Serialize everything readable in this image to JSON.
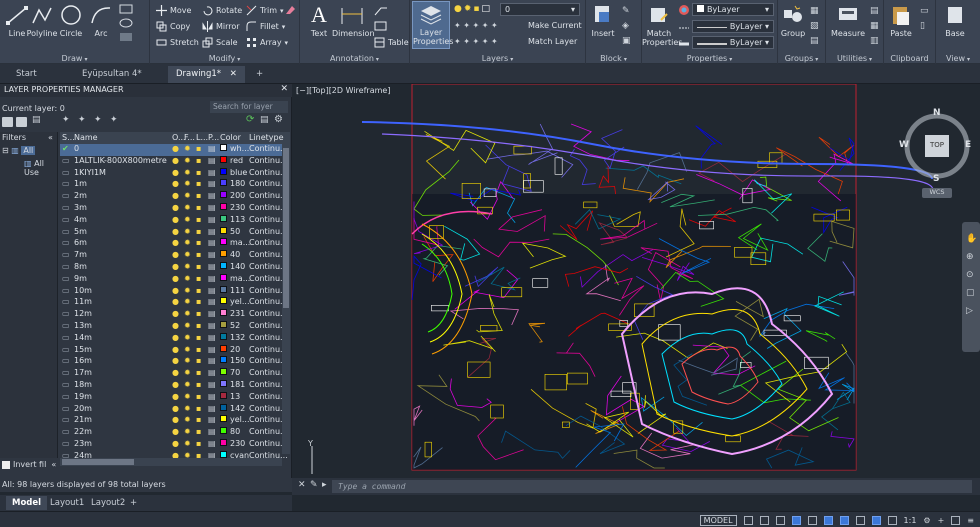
{
  "ribbon": {
    "draw": {
      "line": "Line",
      "polyline": "Polyline",
      "circle": "Circle",
      "arc": "Arc",
      "group": "Draw"
    },
    "modify": {
      "move": "Move",
      "rotate": "Rotate",
      "trim": "Trim",
      "copy": "Copy",
      "mirror": "Mirror",
      "fillet": "Fillet",
      "stretch": "Stretch",
      "scale": "Scale",
      "array": "Array",
      "group": "Modify"
    },
    "annotation": {
      "text": "Text",
      "dimension": "Dimension",
      "table": "Table",
      "group": "Annotation"
    },
    "layers": {
      "layer_properties": "Layer Properties",
      "current_layer": "0",
      "make_current": "Make Current",
      "match_layer": "Match Layer",
      "group": "Layers"
    },
    "block": {
      "insert": "Insert",
      "group": "Block"
    },
    "properties": {
      "match_properties": "Match Properties",
      "color": "ByLayer",
      "linetype": "ByLayer",
      "lineweight": "ByLayer",
      "group": "Properties"
    },
    "groups": {
      "group_btn": "Group",
      "group": "Groups"
    },
    "utilities": {
      "measure": "Measure",
      "group": "Utilities"
    },
    "clipboard": {
      "paste": "Paste",
      "group": "Clipboard"
    },
    "view": {
      "base": "Base",
      "group": "View"
    }
  },
  "doc_tabs": [
    "Start",
    "Eyüpsultan 4*",
    "Drawing1*"
  ],
  "lpm": {
    "title": "LAYER PROPERTIES MANAGER",
    "current_layer": "Current layer: 0",
    "search_placeholder": "Search for layer",
    "filters_label": "Filters",
    "filter_all": "All",
    "filter_used": "All Use",
    "invert_filter": "Invert fil",
    "columns": {
      "status": "S...",
      "name": "Name",
      "on": "O...",
      "freeze": "F...",
      "lock": "L...",
      "plot": "P...",
      "color": "Color",
      "linetype": "Linetype"
    },
    "status": "All: 98 layers displayed of 98 total layers",
    "layers": [
      {
        "name": "0",
        "color": "wh...",
        "hex": "#ffffff",
        "lt": "Continu..."
      },
      {
        "name": "1ALTLIK-800X800metre",
        "color": "red",
        "hex": "#ff0000",
        "lt": "Continu..."
      },
      {
        "name": "1KIYI1M",
        "color": "blue",
        "hex": "#0000ff",
        "lt": "Continu..."
      },
      {
        "name": "1m",
        "color": "180",
        "hex": "#4c3fff",
        "lt": "Continu..."
      },
      {
        "name": "2m",
        "color": "200",
        "hex": "#9a00ff",
        "lt": "Continu..."
      },
      {
        "name": "3m",
        "color": "230",
        "hex": "#ff00a8",
        "lt": "Continu..."
      },
      {
        "name": "4m",
        "color": "113",
        "hex": "#3ac680",
        "lt": "Continu..."
      },
      {
        "name": "5m",
        "color": "50",
        "hex": "#ffdd00",
        "lt": "Continu..."
      },
      {
        "name": "6m",
        "color": "ma...",
        "hex": "#ff00ff",
        "lt": "Continu..."
      },
      {
        "name": "7m",
        "color": "40",
        "hex": "#ff9f00",
        "lt": "Continu..."
      },
      {
        "name": "8m",
        "color": "140",
        "hex": "#00b5ff",
        "lt": "Continu..."
      },
      {
        "name": "9m",
        "color": "ma...",
        "hex": "#ff00ff",
        "lt": "Continu..."
      },
      {
        "name": "10m",
        "color": "111",
        "hex": "#5a7aa2",
        "lt": "Continu..."
      },
      {
        "name": "11m",
        "color": "yel...",
        "hex": "#ffff00",
        "lt": "Continu..."
      },
      {
        "name": "12m",
        "color": "231",
        "hex": "#ff7fd4",
        "lt": "Continu..."
      },
      {
        "name": "13m",
        "color": "52",
        "hex": "#a59e3f",
        "lt": "Continu..."
      },
      {
        "name": "14m",
        "color": "132",
        "hex": "#007a9e",
        "lt": "Continu..."
      },
      {
        "name": "15m",
        "color": "20",
        "hex": "#ff3f00",
        "lt": "Continu..."
      },
      {
        "name": "16m",
        "color": "150",
        "hex": "#007fff",
        "lt": "Continu..."
      },
      {
        "name": "17m",
        "color": "70",
        "hex": "#7fff00",
        "lt": "Continu..."
      },
      {
        "name": "18m",
        "color": "181",
        "hex": "#7f76ff",
        "lt": "Continu..."
      },
      {
        "name": "19m",
        "color": "13",
        "hex": "#a5293f",
        "lt": "Continu..."
      },
      {
        "name": "20m",
        "color": "142",
        "hex": "#00629e",
        "lt": "Continu..."
      },
      {
        "name": "21m",
        "color": "yel...",
        "hex": "#ffff00",
        "lt": "Continu..."
      },
      {
        "name": "22m",
        "color": "80",
        "hex": "#3fff00",
        "lt": "Continu..."
      },
      {
        "name": "23m",
        "color": "230",
        "hex": "#ff00a8",
        "lt": "Continu..."
      },
      {
        "name": "24m",
        "color": "cyan",
        "hex": "#00ffff",
        "lt": "Continu..."
      }
    ]
  },
  "viewport": {
    "label": "[−][Top][2D Wireframe]"
  },
  "viewcube": {
    "top": "TOP",
    "n": "N",
    "s": "S",
    "e": "E",
    "w": "W",
    "wcs": "WCS"
  },
  "command": {
    "placeholder": "Type a command"
  },
  "layout_tabs": [
    "Model",
    "Layout1",
    "Layout2"
  ],
  "statusbar": {
    "model": "MODEL",
    "scale": "1:1"
  }
}
